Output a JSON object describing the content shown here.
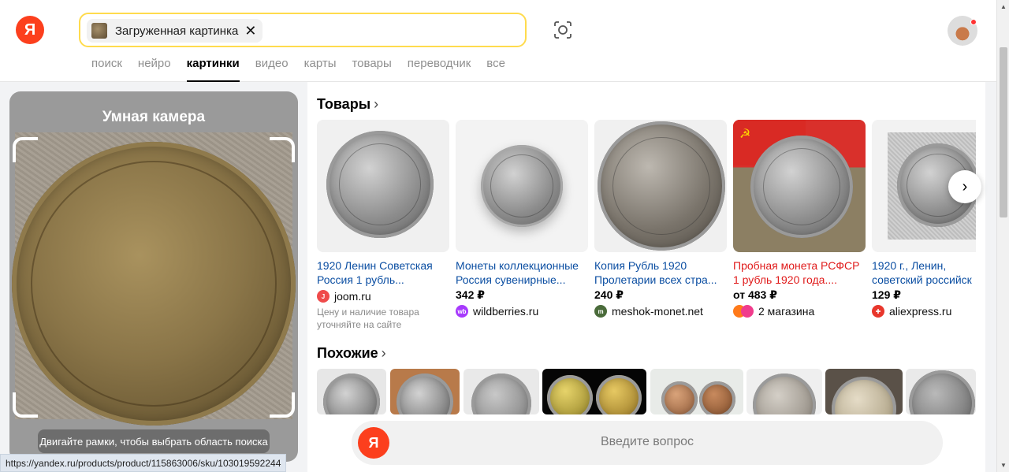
{
  "header": {
    "logo_letter": "Я",
    "search_chip_label": "Загруженная картинка",
    "chip_close": "✕",
    "tabs": [
      {
        "label": "поиск"
      },
      {
        "label": "нейро"
      },
      {
        "label": "картинки",
        "active": true
      },
      {
        "label": "видео"
      },
      {
        "label": "карты"
      },
      {
        "label": "товары"
      },
      {
        "label": "переводчик"
      },
      {
        "label": "все"
      }
    ]
  },
  "camera_panel": {
    "title": "Умная камера",
    "hint": "Двигайте рамки, чтобы выбрать область поиска"
  },
  "products_section": {
    "title": "Товары",
    "items": [
      {
        "title_line1": "1920 Ленин Советская",
        "title_line2": "Россия 1 рубль...",
        "price": "",
        "shop": "joom.ru",
        "shop_icon": "joom-icon",
        "shop_color": "#ef4b4b",
        "note": "Цену и наличие товара уточняйте на сайте"
      },
      {
        "title_line1": "Монеты коллекционные",
        "title_line2": "Россия сувенирные...",
        "price": "342 ₽",
        "shop": "wildberries.ru",
        "shop_icon": "wildberries-icon",
        "shop_color": "#a73afd",
        "note": ""
      },
      {
        "title_line1": "Копия Рубль 1920",
        "title_line2": "Пролетарии всех стра...",
        "price": "240 ₽",
        "shop": "meshok-monet.net",
        "shop_icon": "meshok-icon",
        "shop_color": "#4a6b3a",
        "note": ""
      },
      {
        "title_line1": "Пробная монета РСФСР",
        "title_line2": "1 рубль 1920 года....",
        "price": "от 483 ₽",
        "shop": "2 магазина",
        "shop_icon": "multi-shop-icon",
        "shop_color": "#ff7a1a",
        "note": "",
        "highlight": true
      },
      {
        "title_line1": "1920 г., Ленин,",
        "title_line2": "советский российск",
        "price": "129 ₽",
        "shop": "aliexpress.ru",
        "shop_icon": "aliexpress-icon",
        "shop_color": "#e8372c",
        "note": ""
      }
    ]
  },
  "similar_section": {
    "title": "Похожие"
  },
  "ask": {
    "placeholder": "Введите вопрос"
  },
  "status_url": "https://yandex.ru/products/product/115863006/sku/103019592244",
  "colors": {
    "brand_red": "#fc3f1d",
    "search_border": "#ffdb4d",
    "link_blue": "#0b4ea2",
    "promo_red": "#e01b1b"
  }
}
